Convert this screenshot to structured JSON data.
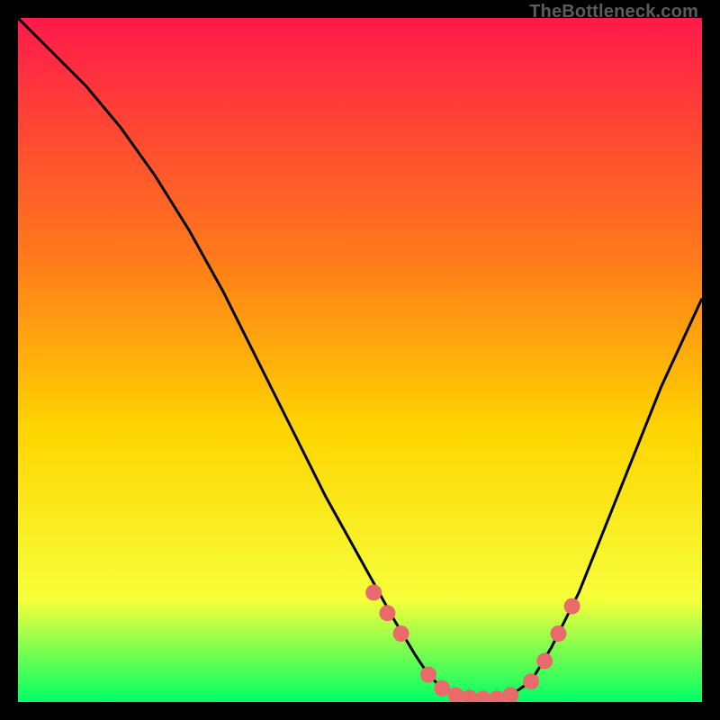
{
  "watermark": "TheBottleneck.com",
  "colors": {
    "bg_black": "#000000",
    "grad_top": "#ff1a4a",
    "grad_mid1": "#ff7a1a",
    "grad_mid2": "#ffd400",
    "grad_mid3": "#f6ff3a",
    "grad_bottom": "#00ff66",
    "curve": "#000000",
    "dot": "#e86a6a",
    "watermark": "#5c5c5c"
  },
  "chart_data": {
    "type": "line",
    "title": "",
    "xlabel": "",
    "ylabel": "",
    "xlim": [
      0,
      100
    ],
    "ylim": [
      0,
      100
    ],
    "grid": false,
    "series": [
      {
        "name": "bottleneck-curve",
        "x": [
          0,
          5,
          10,
          15,
          20,
          25,
          30,
          35,
          40,
          45,
          50,
          55,
          58,
          60,
          62,
          65,
          68,
          70,
          72,
          75,
          78,
          82,
          86,
          90,
          94,
          100
        ],
        "y": [
          100,
          95,
          90,
          84,
          77,
          69,
          60,
          50,
          40,
          30,
          21,
          12,
          7,
          4,
          2,
          1,
          0.5,
          0.5,
          1,
          3,
          8,
          16,
          26,
          36,
          46,
          59
        ]
      }
    ],
    "markers": {
      "name": "highlight-dots",
      "x": [
        52,
        54,
        56,
        60,
        62,
        64,
        66,
        68,
        70,
        72,
        75,
        77,
        79,
        81
      ],
      "y": [
        16,
        13,
        10,
        4,
        2,
        1,
        0.6,
        0.5,
        0.5,
        1,
        3,
        6,
        10,
        14
      ]
    },
    "annotations": []
  }
}
